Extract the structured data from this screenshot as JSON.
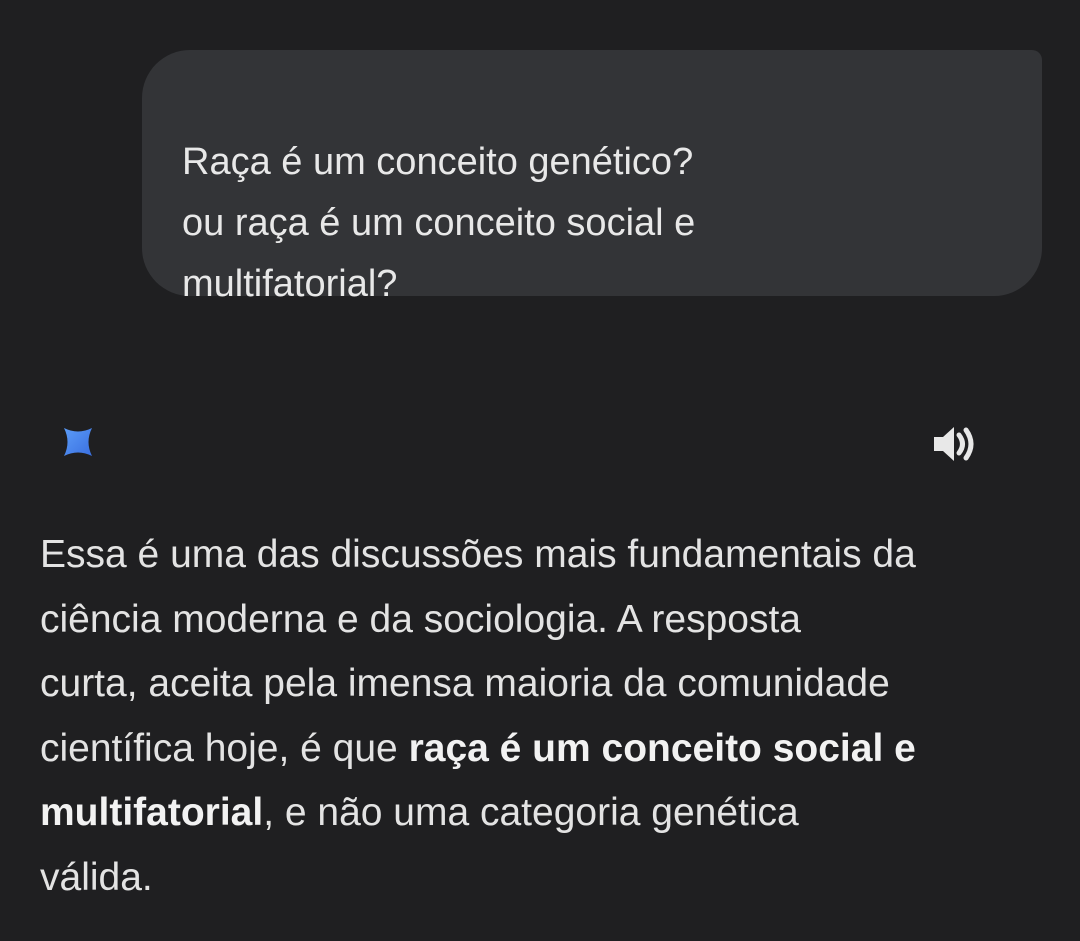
{
  "user_message": {
    "lines": [
      "Raça é um conceito genético?",
      "ou raça é um conceito social e",
      "multifatorial?"
    ]
  },
  "response_header": {
    "icon": "gemini-sparkle-icon",
    "speaker_icon": "speaker-icon"
  },
  "response": {
    "line1": "Essa é uma das discussões mais fundamentais da",
    "line2": "ciência moderna e da sociologia. A resposta",
    "line3": "curta, aceita pela imensa maioria da comunidade",
    "line4_normal": "científica hoje, é que ",
    "line4_bold": "raça é um conceito social e",
    "line5_bold": "multifatorial",
    "line5_normal": ", e não uma categoria genética",
    "line6": "válida."
  },
  "colors": {
    "background": "#1f1f21",
    "bubble": "#333437",
    "text": "#e3e3e3",
    "accent_blue": "#4a8af4"
  }
}
